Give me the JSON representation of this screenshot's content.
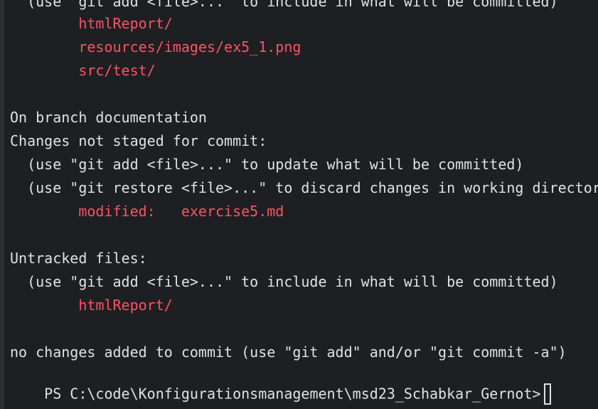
{
  "terminal": {
    "lines": [
      "  (use \"git add <file>...\" to include in what will be committed)",
      "        htmlReport/",
      "        resources/images/ex5_1.png",
      "        src/test/",
      "",
      "On branch documentation",
      "Changes not staged for commit:",
      "  (use \"git add <file>...\" to update what will be committed)",
      "  (use \"git restore <file>...\" to discard changes in working directory)",
      "        modified:   exercise5.md",
      "",
      "Untracked files:",
      "  (use \"git add <file>...\" to include in what will be committed)",
      "        htmlReport/",
      "",
      "no changes added to commit (use \"git add\" and/or \"git commit -a\")",
      "PS C:\\code\\Konfigurationsmanagement\\msd23_Schabkar_Gernot>"
    ]
  },
  "colors": {
    "background": "#1e1f22",
    "text": "#dfe1e5",
    "untracked": "#f75464"
  }
}
